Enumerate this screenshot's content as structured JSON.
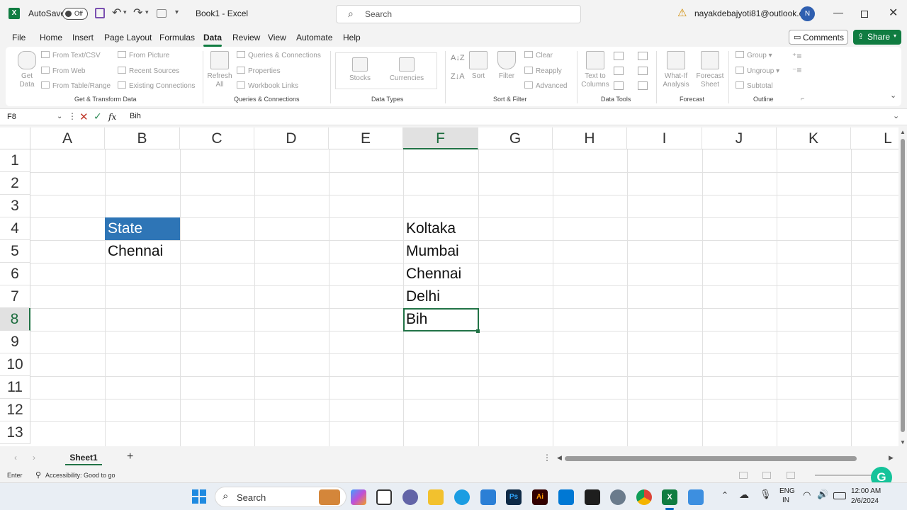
{
  "window": {
    "autosave_label": "AutoSave",
    "autosave_state": "Off",
    "title": "Book1  -  Excel",
    "search_placeholder": "Search",
    "account_email": "nayakdebajyoti81@outlook.com",
    "avatar_initial": "N"
  },
  "menu": {
    "tabs": [
      "File",
      "Home",
      "Insert",
      "Page Layout",
      "Formulas",
      "Data",
      "Review",
      "View",
      "Automate",
      "Help"
    ],
    "active": "Data",
    "comments_label": "Comments",
    "share_label": "Share"
  },
  "ribbon": {
    "get_transform": {
      "get_data": "Get Data",
      "from_text_csv": "From Text/CSV",
      "from_web": "From Web",
      "from_table_range": "From Table/Range",
      "from_picture": "From Picture",
      "recent_sources": "Recent Sources",
      "existing_connections": "Existing Connections",
      "label": "Get & Transform Data"
    },
    "queries": {
      "refresh_all": "Refresh All",
      "queries_connections": "Queries & Connections",
      "properties": "Properties",
      "workbook_links": "Workbook Links",
      "label": "Queries & Connections"
    },
    "data_types": {
      "stocks": "Stocks",
      "currencies": "Currencies",
      "label": "Data Types"
    },
    "sort_filter": {
      "sort": "Sort",
      "filter": "Filter",
      "clear": "Clear",
      "reapply": "Reapply",
      "advanced": "Advanced",
      "label": "Sort & Filter"
    },
    "data_tools": {
      "text_to_columns": "Text to Columns",
      "label": "Data Tools"
    },
    "forecast": {
      "what_if": "What-If Analysis",
      "forecast_sheet": "Forecast Sheet",
      "label": "Forecast"
    },
    "outline": {
      "group": "Group",
      "ungroup": "Ungroup",
      "subtotal": "Subtotal",
      "label": "Outline"
    }
  },
  "formula_bar": {
    "name_box": "F8",
    "fx": "fx",
    "value": "Bih"
  },
  "grid": {
    "columns": [
      "A",
      "B",
      "C",
      "D",
      "E",
      "F",
      "G",
      "H",
      "I",
      "J",
      "K",
      "L"
    ],
    "selected_column": "F",
    "rows": [
      "1",
      "2",
      "3",
      "4",
      "5",
      "6",
      "7",
      "8",
      "9",
      "10",
      "11",
      "12",
      "13"
    ],
    "selected_row": "8",
    "cells": {
      "B4": "State",
      "B5": "Chennai",
      "F4": "Koltaka",
      "F5": "Mumbai",
      "F6": "Chennai",
      "F7": "Delhi",
      "F8": "Bih"
    }
  },
  "sheets": {
    "tabs": [
      "Sheet1"
    ],
    "add_label": "+"
  },
  "status": {
    "mode": "Enter",
    "accessibility": "Accessibility: Good to go"
  },
  "taskbar": {
    "search_label": "Search",
    "language": "ENG",
    "region": "IN",
    "time": "12:00 AM",
    "date": "2/6/2024"
  },
  "colors": {
    "excel_green": "#107c41",
    "header_fill": "#2e75b6"
  }
}
